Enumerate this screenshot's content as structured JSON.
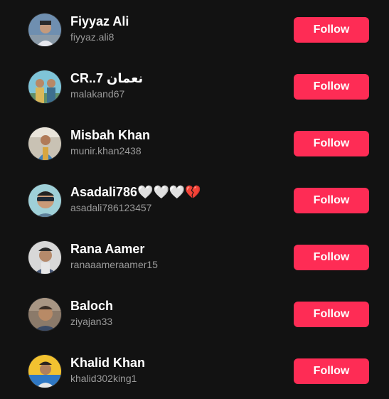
{
  "theme": {
    "background": "#121212",
    "accent": "#fe2c55",
    "name_color": "#ffffff",
    "handle_color": "#9a9a9a"
  },
  "users": [
    {
      "name": "Fiyyaz Ali",
      "handle": "fiyyaz.ali8",
      "follow_label": "Follow"
    },
    {
      "name": "CR..7 نعمان",
      "handle": "malakand67",
      "follow_label": "Follow"
    },
    {
      "name": "Misbah Khan",
      "handle": "munir.khan2438",
      "follow_label": "Follow"
    },
    {
      "name": "Asadali786🤍🤍🤍💔",
      "handle": "asadali786123457",
      "follow_label": "Follow"
    },
    {
      "name": "Rana Aamer",
      "handle": "ranaaameraamer15",
      "follow_label": "Follow"
    },
    {
      "name": "Baloch",
      "handle": "ziyajan33",
      "follow_label": "Follow"
    },
    {
      "name": "Khalid Khan",
      "handle": "khalid302king1",
      "follow_label": "Follow"
    }
  ]
}
